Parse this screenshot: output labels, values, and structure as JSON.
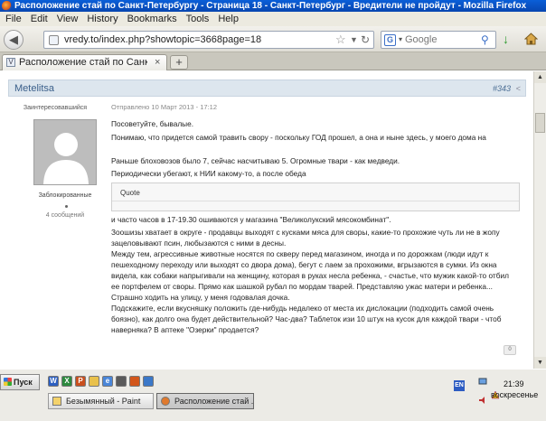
{
  "window": {
    "title": "Расположение стай по Санкт-Петербургу - Страница 18 - Санкт-Петербург - Вредители не пройдут - Mozilla Firefox"
  },
  "menu": [
    "File",
    "Edit",
    "View",
    "History",
    "Bookmarks",
    "Tools",
    "Help"
  ],
  "nav": {
    "back_icon": "back-arrow-icon",
    "url": "vredy.to/index.php?showtopic=3668page=18",
    "search_placeholder": "Google",
    "search_engine": "G"
  },
  "tab": {
    "label": "Расположение стай по Санкт-Петербургу ...",
    "close": "×",
    "new_tab": "+"
  },
  "post": {
    "author": "Metelitsa",
    "number": "#343",
    "rank": "Заинтересовавшийся",
    "blocked": "Заблокированные",
    "messages": "4 сообщений",
    "date": "Отправлено 10 Март 2013 - 17:12",
    "quote_label": "Quote",
    "lines_before_quote": [
      "Посоветуйте, бывалые.",
      "Понимаю, что придется самой травить свору - поскольку ГОД прошел, а она и ныне здесь, у моего дома на",
      "",
      "Раньше блоховозов было 7, сейчас насчитываю 5. Огромные твари - как медведи.",
      "Периодически убегают,                          к НИИ какому-то, а после обеда"
    ],
    "lines_after_quote": [
      "и часто часов  в 17-19.30 ошиваются у магазина \"Великолукский мясокомбинат\".",
      "Зоошизы хватает в округе - продавцы выходят с кусками мяса для своры, какие-то прохожие чуть ли не в жопу",
      "зацеловывают псин, любызаются с ними в десны.",
      "Между тем, агрессивные животные носятся по скверу перед магазином, иногда и по дорожкам (люди идут к",
      "пешеходному переходу или выходят со двора дома), бегут с лаем за прохожими, вгрызаются в сумки. Из окна",
      "видела, как собаки напрыгивали на женщину, которая в руках несла ребенка, - счастье, что мужик какой-то отбил",
      "ее портфелем от своры. Прямо как шашкой рубал по мордам тварей. Представляю ужас матери и ребенка...",
      "Страшно ходить на улицу, у меня годовалая дочка.",
      "Подскажите, если вкусняшку положить где-нибудь недалеко от места их дислокации (подходить самой очень",
      "боязно), как долго она будет действительной? Час-два? Таблеток изи 10 штук на кусок для каждой твари - чтоб",
      "наверняка? В аптеке \"Озерки\" продается?"
    ],
    "badge": "0"
  },
  "taskbar": {
    "start": "Пуск",
    "buttons": [
      {
        "label": "Безымянный - Paint"
      },
      {
        "label": "Расположение стай ..."
      }
    ],
    "lang": "EN",
    "time": "21:39",
    "day": "воскресенье"
  }
}
